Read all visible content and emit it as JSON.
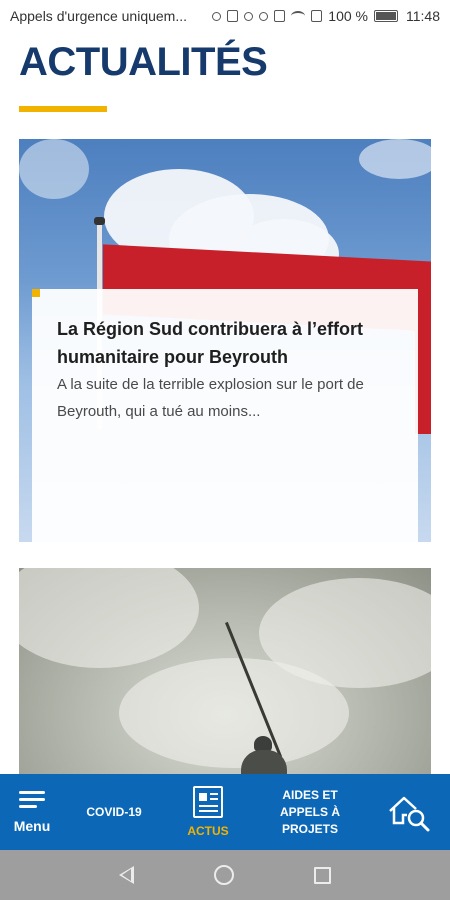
{
  "status_bar": {
    "carrier": "Appels d'urgence uniquem...",
    "battery_text": "100 %",
    "time": "11:48"
  },
  "page": {
    "title": "ACTUALITÉS"
  },
  "articles": [
    {
      "title": "La Région Sud contribuera à l’effort humanitaire pour Beyrouth",
      "excerpt": "A la suite de la terrible explosion sur le port de Beyrouth, qui a tué au moins..."
    }
  ],
  "bottom_nav": {
    "menu_label": "Menu",
    "covid_label": "COVID-19",
    "actus_label": "ACTUS",
    "aides_label": "AIDES ET APPELS À PROJETS"
  },
  "colors": {
    "brand_blue": "#0c68b7",
    "title_navy": "#153a6b",
    "accent_yellow": "#f2b200"
  },
  "icons": {
    "menu": "hamburger-icon",
    "actus": "newspaper-icon",
    "search": "house-search-icon"
  }
}
